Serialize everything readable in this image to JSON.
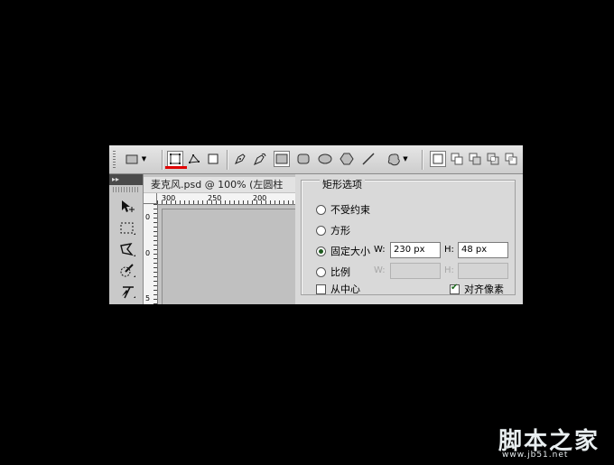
{
  "toolbar": {
    "tool_preset_icon": "rectangle-icon",
    "mode_buttons": [
      "shape-layers-icon",
      "paths-icon",
      "fill-pixels-icon"
    ],
    "shape_tools": [
      "pen-icon",
      "freeform-pen-icon",
      "rectangle-tool-icon",
      "rounded-rectangle-icon",
      "ellipse-icon",
      "polygon-icon",
      "line-icon",
      "custom-shape-icon"
    ],
    "path_ops": [
      "create-new-icon",
      "add-icon",
      "subtract-icon",
      "intersect-icon",
      "exclude-icon"
    ],
    "active_mode_underline_color": "#e00000"
  },
  "tools_panel": {
    "collapse_label": "▸▸",
    "tools": [
      "move-tool-icon",
      "marquee-tool-icon",
      "lasso-tool-icon",
      "quick-select-tool-icon",
      "crop-tool-icon"
    ]
  },
  "document": {
    "tab_title": "麦克风.psd @ 100% (左圆柱",
    "ruler_top_labels": [
      "300",
      "250",
      "200"
    ],
    "ruler_left_labels": [
      "0",
      "0",
      "5"
    ]
  },
  "rect_options": {
    "title": "矩形选项",
    "unconstrained": "不受约束",
    "square": "方形",
    "fixed_size": "固定大小",
    "proportional": "比例",
    "from_center": "从中心",
    "snap_to_pixels": "对齐像素",
    "w_label": "W:",
    "h_label": "H:",
    "fixed_w": "230 px",
    "fixed_h": "48 px",
    "prop_w": "",
    "prop_h": "",
    "selected": "fixed_size",
    "from_center_checked": false,
    "snap_checked": true
  },
  "watermark": {
    "text": "脚本之家",
    "url": "www.jb51.net"
  }
}
